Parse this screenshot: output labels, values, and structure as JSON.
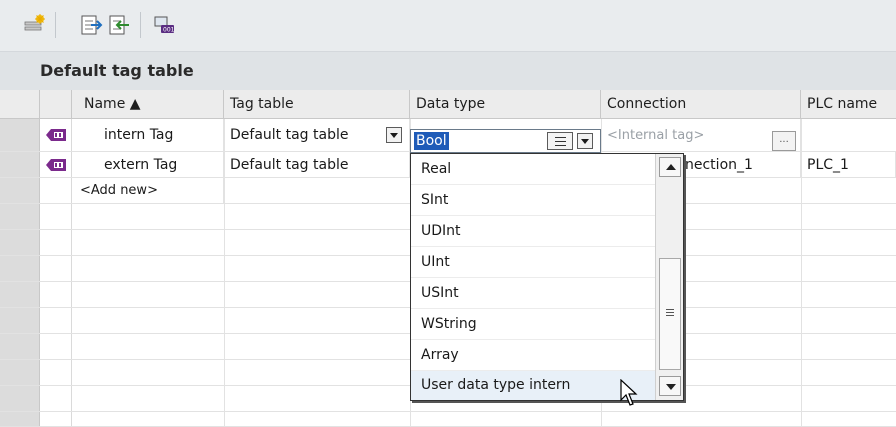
{
  "toolbar": {
    "buttons": [
      "add-tag-icon",
      "export-icon",
      "import-icon",
      "monitor-icon"
    ]
  },
  "tag_table": {
    "title": "Default tag table",
    "columns": [
      "Name ▲",
      "Tag table",
      "Data type",
      "Connection",
      "PLC name"
    ],
    "rows": [
      {
        "name": "intern Tag",
        "tag_table": "Default tag table",
        "data_type": "Bool",
        "connection": "<Internal tag>",
        "plc_name": ""
      },
      {
        "name": "extern Tag",
        "tag_table": "Default tag table",
        "data_type": "",
        "connection": "nection_1",
        "plc_name": "PLC_1"
      }
    ],
    "add_new": "<Add new>"
  },
  "data_type_dropdown": {
    "items": [
      "Real",
      "SInt",
      "UDInt",
      "UInt",
      "USInt",
      "WString",
      "Array",
      "User data type intern"
    ],
    "hovered": "User data type intern"
  },
  "colors": {
    "selection": "#1e5bb8",
    "tag_icon": "#7b2a8c",
    "header_bg": "#ececec",
    "title_bg": "#dfe3e6"
  }
}
